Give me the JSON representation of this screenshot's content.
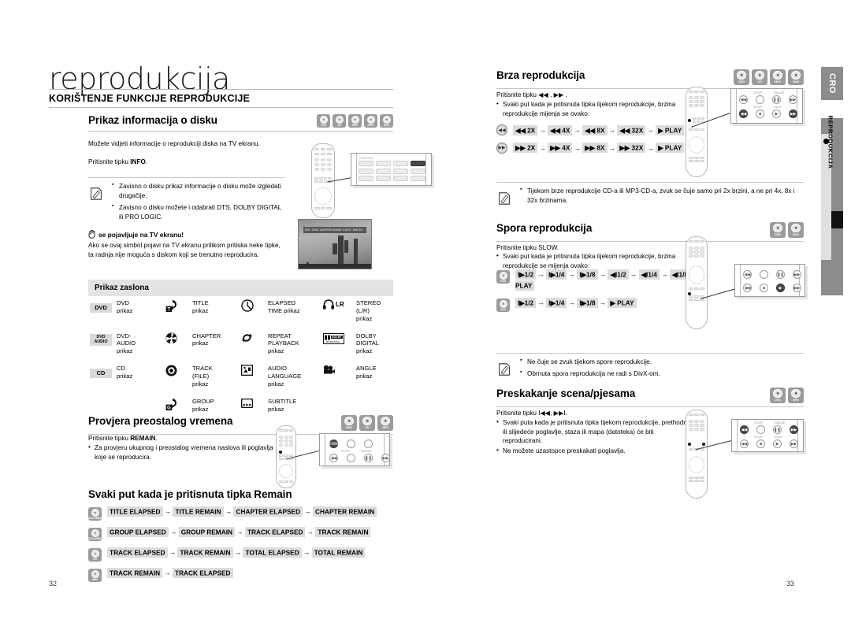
{
  "document": {
    "chapter_title": "reprodukcija",
    "section_title": "KORIŠTENJE FUNKCIJE REPRODUKCIJE",
    "left_page_number": "32",
    "right_page_number": "33"
  },
  "side_tabs": {
    "language_code": "CRO",
    "vertical_label": "REPRODUKCIJA"
  },
  "disc_labels": {
    "dvd": "DVD",
    "cd": "CD",
    "mp3": "MP3",
    "jpeg": "JPEG",
    "divx": "DivX",
    "dvd_audio": "DVD-AUDIO"
  },
  "sections": {
    "disc_info": {
      "heading": "Prikaz informacija o disku",
      "discs": [
        "DVD",
        "CD",
        "MP3",
        "JPEG",
        "DivX"
      ],
      "intro": "Možete vidjeti informacije o reprodukciji diska na TV ekranu.",
      "press": "Pritisnite tipku INFO.",
      "press_plain": "Pritisnite tipku ",
      "press_bold": "INFO",
      "press_end": ".",
      "notes": [
        "Zavisno o disku prikaz informacije o disku može izgledati drugačije.",
        "Zavisno o disku možete i odabrati DTS, DOLBY DIGITAL ili PRO LOGIC."
      ],
      "warning_title": "se pojavljuje na TV ekranu!",
      "warning_body": "Ako se ovaj simbol pojavi na TV ekranu prilikom pritiska neke tipke, ta radnja nije moguća s diskom koji se trenutno reproducira.",
      "osd_preview": {
        "items": [
          "DVD",
          "01/05",
          "CHAPTER 001/040",
          "0:00:27",
          "ENG 5/1"
        ]
      }
    },
    "osd_table": {
      "panel_title": "Prikaz zaslona",
      "rows": [
        [
          {
            "icon": "dvd-tag",
            "tag": "DVD",
            "text": "DVD\nprikaz"
          },
          {
            "icon": "title-icon",
            "text": "TITLE\nprikaz"
          },
          {
            "icon": "elapsed-clock-icon",
            "text": "ELAPSED\nTIME prikaz"
          },
          {
            "icon": "headphone-lr-icon",
            "text": "STEREO (L/R)\nprikaz"
          }
        ],
        [
          {
            "icon": "dvd-audio-tag",
            "tag": "DVD AUDIO",
            "text": "DVD-\nAUDIO\nprikaz"
          },
          {
            "icon": "chapter-disc-icon",
            "text": "CHAPTER\nprikaz"
          },
          {
            "icon": "repeat-icon",
            "text": "REPEAT\nPLAYBACK\nprikaz"
          },
          {
            "icon": "dolby-digital-icon",
            "text": "DOLBY\nDIGITAL prikaz"
          }
        ],
        [
          {
            "icon": "cd-tag",
            "tag": "CD",
            "text": "CD\nprikaz"
          },
          {
            "icon": "track-file-icon",
            "text": "TRACK\n(FILE)\nprikaz"
          },
          {
            "icon": "audio-language-icon",
            "text": "AUDIO\nLANGUAGE\nprikaz"
          },
          {
            "icon": "angle-camera-icon",
            "text": "ANGLE prikaz"
          }
        ],
        [
          {
            "icon": "",
            "text": ""
          },
          {
            "icon": "group-icon",
            "text": "GROUP\nprikaz"
          },
          {
            "icon": "subtitle-icon",
            "text": "SUBTITLE\nprikaz"
          },
          {
            "icon": "",
            "text": ""
          }
        ]
      ]
    },
    "remaining_time": {
      "heading": "Provjera preostalog vremena",
      "discs": [
        "DVD",
        "CD",
        "MP3"
      ],
      "press_plain": "Pritisnite tipku ",
      "press_bold": "REMAIN",
      "press_end": ".",
      "bullets": [
        "Za provjeru ukupnog i preostalog vremena naslova ili poglavlja koje se reproducira."
      ],
      "callout_buttons": [
        "REMAIN",
        "STOP",
        "PAUSE"
      ],
      "sub_heading": "Svaki put kada je pritisnuta tipka Remain",
      "sequences": [
        {
          "disc": "DVD-VIDEO",
          "steps": [
            "TITLE ELAPSED",
            "TITLE REMAIN",
            "CHAPTER ELAPSED",
            "CHAPTER REMAIN"
          ]
        },
        {
          "disc": "DVD-AUDIO",
          "steps": [
            "GROUP ELAPSED",
            "GROUP REMAIN",
            "TRACK ELAPSED",
            "TRACK REMAIN"
          ]
        },
        {
          "disc": "CD",
          "steps": [
            "TRACK ELAPSED",
            "TRACK REMAIN",
            "TOTAL ELAPSED",
            "TOTAL REMAIN"
          ]
        },
        {
          "disc": "MP3",
          "steps": [
            "TRACK REMAIN",
            "TRACK ELAPSED"
          ]
        }
      ]
    },
    "fast_playback": {
      "heading": "Brza reprodukcija",
      "discs": [
        "DVD",
        "CD",
        "MP3",
        "DivX"
      ],
      "press": "Pritisnite tipku ◀◀ , ▶▶ .",
      "bullets": [
        "Svaki put kada je pritisnuta tipka tijekom reprodukcije, brzina reprodukcije mijenja se ovako:"
      ],
      "sequences": [
        {
          "button": "rewind",
          "steps": [
            "◀◀ 2X",
            "◀◀ 4X",
            "◀◀ 8X",
            "◀◀ 32X",
            "▶ PLAY"
          ]
        },
        {
          "button": "forward",
          "steps": [
            "▶▶ 2X",
            "▶▶ 4X",
            "▶▶ 8X",
            "▶▶ 32X",
            "▶ PLAY"
          ]
        }
      ],
      "notes": [
        "Tijekom brze reprodukcije CD-a ili MP3-CD-a, zvuk se čuje samo pri 2x brzini, a ne pri 4x, 8x i 32x brzinama."
      ]
    },
    "slow_playback": {
      "heading": "Spora reprodukcija",
      "discs": [
        "DVD",
        "DivX"
      ],
      "press": "Pritisnite tipku SLOW.",
      "bullets": [
        "Svaki put kada je pritisnuta tipka tijekom reprodukcije, brzina reprodukcije se mijenja ovako:"
      ],
      "sequences": [
        {
          "disc": "DVD",
          "steps": [
            "I▶1/2",
            "I▶1/4",
            "I▶1/8",
            "◀I1/2",
            "◀I1/4",
            "◀I1/8",
            "▶ PLAY"
          ]
        },
        {
          "disc": "DivX",
          "steps": [
            "I▶1/2",
            "I▶1/4",
            "I▶1/8",
            "▶ PLAY"
          ]
        }
      ],
      "notes": [
        "Ne čuje se zvuk tijekom spore reprodukcije.",
        "Obrnuta spora reprodukcija ne radi s DivX-om."
      ]
    },
    "skip_scenes": {
      "heading": "Preskakanje scena/pjesama",
      "discs": [
        "DVD",
        "MP3"
      ],
      "press": "Pritisnite tipku I◀◀, ▶▶I.",
      "bullets": [
        "Svaki puta kada je pritisnuta tipka tijekom reprodukcije, prethodno ili slijedeće poglavlje, staza ili mapa (datoteka) će biti reproducirani.",
        "Ne možete uzastopce preskakati poglavlja."
      ],
      "callout_labels": [
        "STOP",
        "PAUSE",
        "STOP",
        "PLAY"
      ]
    }
  }
}
